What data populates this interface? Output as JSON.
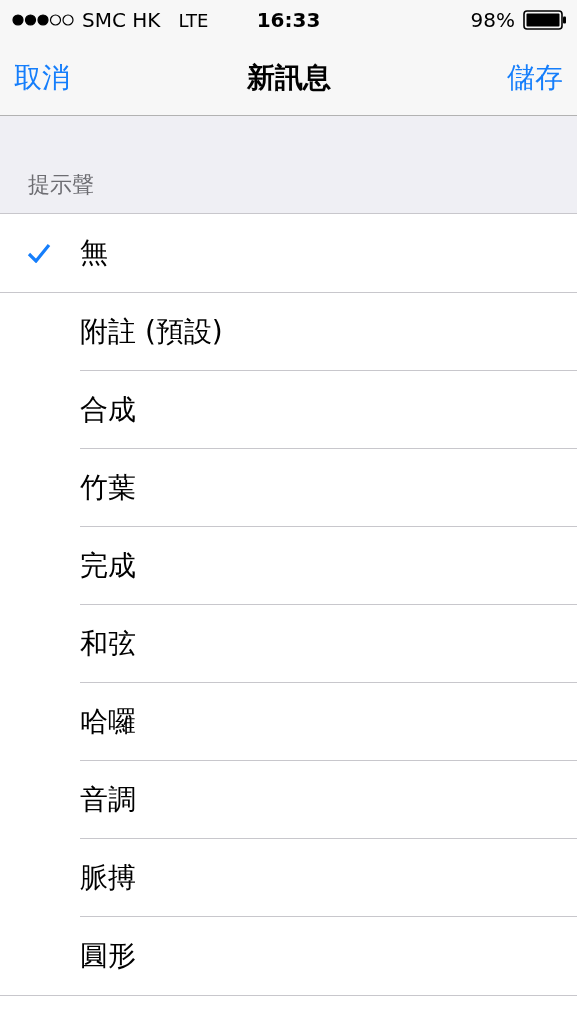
{
  "status_bar": {
    "carrier": "SMC HK",
    "network": "LTE",
    "time": "16:33",
    "battery": "98%"
  },
  "nav": {
    "left": "取消",
    "title": "新訊息",
    "right": "儲存"
  },
  "section_header": "提示聲",
  "groups": [
    {
      "items": [
        {
          "label": "無",
          "selected": true
        }
      ]
    },
    {
      "items": [
        {
          "label": "附註 (預設)",
          "selected": false
        },
        {
          "label": "合成",
          "selected": false
        },
        {
          "label": "竹葉",
          "selected": false
        },
        {
          "label": "完成",
          "selected": false
        },
        {
          "label": "和弦",
          "selected": false
        },
        {
          "label": "哈囉",
          "selected": false
        },
        {
          "label": "音調",
          "selected": false
        },
        {
          "label": "脈搏",
          "selected": false
        },
        {
          "label": "圓形",
          "selected": false
        }
      ]
    }
  ]
}
